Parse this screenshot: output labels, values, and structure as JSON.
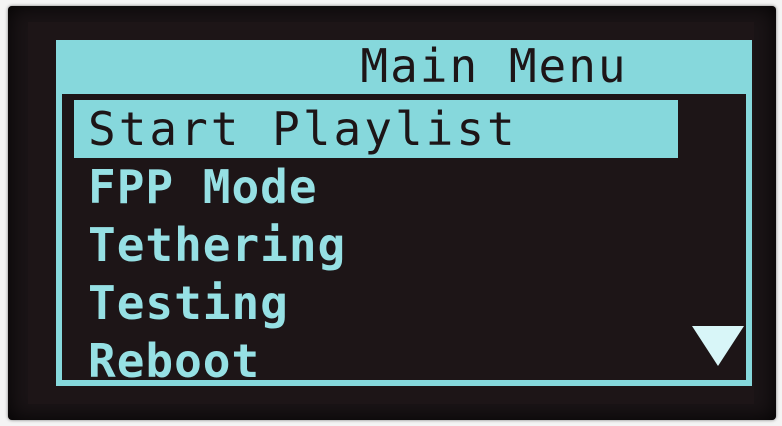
{
  "title": "Main Menu",
  "menu": {
    "items": [
      {
        "label": "Start Playlist",
        "selected": true
      },
      {
        "label": "FPP Mode",
        "selected": false
      },
      {
        "label": "Tethering",
        "selected": false
      },
      {
        "label": "Testing",
        "selected": false
      },
      {
        "label": "Reboot",
        "selected": false
      }
    ],
    "scroll_icon": "triangle-down-icon"
  },
  "colors": {
    "foreground": "#86d8dc",
    "background": "#1d1517"
  }
}
